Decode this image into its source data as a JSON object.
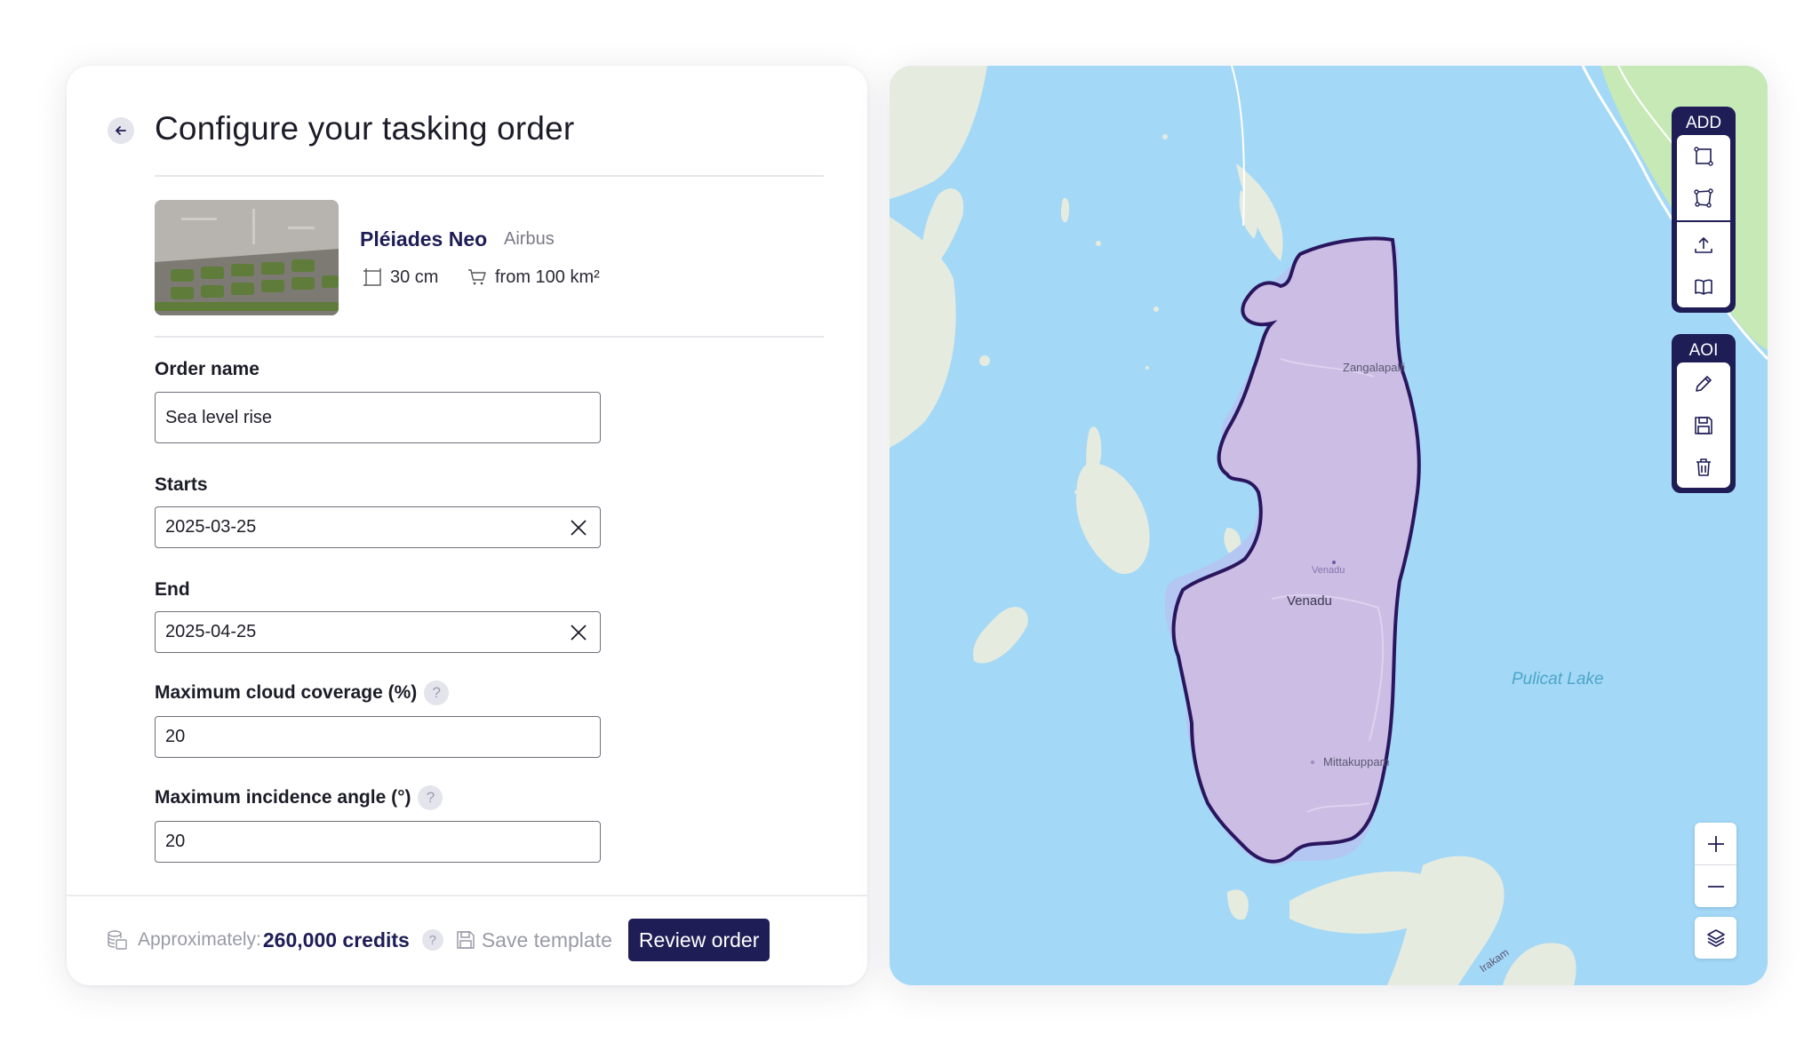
{
  "header": {
    "title": "Configure your tasking order"
  },
  "product": {
    "name": "Pléiades Neo",
    "vendor": "Airbus",
    "resolution": "30 cm",
    "min_area": "from 100 km²"
  },
  "form": {
    "order_name": {
      "label": "Order name",
      "value": "Sea level rise"
    },
    "starts": {
      "label": "Starts",
      "value": "2025-03-25"
    },
    "end": {
      "label": "End",
      "value": "2025-04-25"
    },
    "cloud": {
      "label": "Maximum cloud coverage (%)",
      "value": "20"
    },
    "incidence": {
      "label": "Maximum incidence angle (°)",
      "value": "20"
    },
    "help_glyph": "?"
  },
  "footer": {
    "approx_label": "Approximately:",
    "credits": "260,000 credits",
    "save_template": "Save template",
    "review": "Review order"
  },
  "map": {
    "labels": {
      "zangalapalli": "Zangalapalli",
      "venadu_small": "Venadu",
      "venadu": "Venadu",
      "mittakuppam": "Mittakuppam",
      "pulicat": "Pulicat Lake",
      "irakam": "Irakam"
    },
    "toolbar_add": "ADD",
    "toolbar_aoi": "AOI",
    "colors": {
      "water": "#a3d8f7",
      "land": "#e6ebdf",
      "aoi_fill": "#cbbde3",
      "aoi_stroke": "#2a165f",
      "accent": "#1e1d56"
    }
  }
}
